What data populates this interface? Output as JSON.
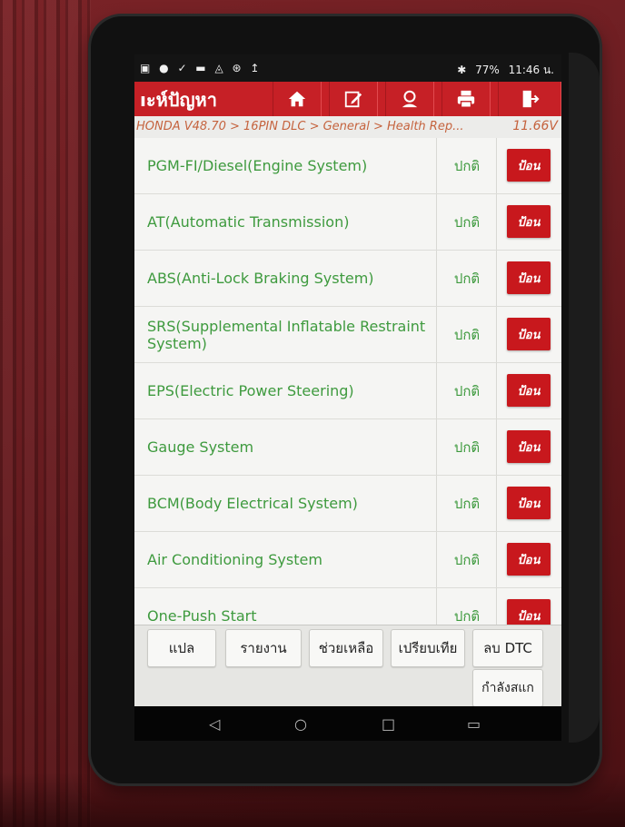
{
  "statusbar": {
    "left_icons": "▣ ● ✓ ▬ ◬ ⊛ ↥",
    "bluetooth": "✱",
    "battery": "77%",
    "time": "11:46 น."
  },
  "app": {
    "title": "ıะห์ปัญหา",
    "header_buttons": [
      "home-icon",
      "edit-icon",
      "user-icon",
      "print-icon",
      "exit-icon"
    ]
  },
  "breadcrumb": {
    "path": "HONDA V48.70 > 16PIN DLC > General > Health Rep...",
    "voltage": "11.66V"
  },
  "systems": [
    {
      "name": "PGM-FI/Diesel(Engine System)",
      "status": "ปกติ",
      "action": "ป้อน"
    },
    {
      "name": "AT(Automatic Transmission)",
      "status": "ปกติ",
      "action": "ป้อน"
    },
    {
      "name": "ABS(Anti-Lock Braking System)",
      "status": "ปกติ",
      "action": "ป้อน"
    },
    {
      "name": "SRS(Supplemental Inflatable Restraint System)",
      "status": "ปกติ",
      "action": "ป้อน"
    },
    {
      "name": "EPS(Electric Power Steering)",
      "status": "ปกติ",
      "action": "ป้อน"
    },
    {
      "name": "Gauge System",
      "status": "ปกติ",
      "action": "ป้อน"
    },
    {
      "name": "BCM(Body Electrical System)",
      "status": "ปกติ",
      "action": "ป้อน"
    },
    {
      "name": "Air Conditioning System",
      "status": "ปกติ",
      "action": "ป้อน"
    },
    {
      "name": "One-Push Start",
      "status": "ปกติ",
      "action": "ป้อน"
    }
  ],
  "buttons": {
    "translate": "แปล",
    "report": "รายงาน",
    "help": "ช่วยเหลือ",
    "compare": "เปรียบเทีย",
    "clear_dtc": "ลบ DTC",
    "processing": "กำลังสแก"
  },
  "nav": {
    "back": "◁",
    "home": "○",
    "recent": "□",
    "extra": "▭"
  },
  "colors": {
    "accent": "#c62026",
    "text_green": "#3e9a3e",
    "breadcrumb": "#c5633e"
  }
}
